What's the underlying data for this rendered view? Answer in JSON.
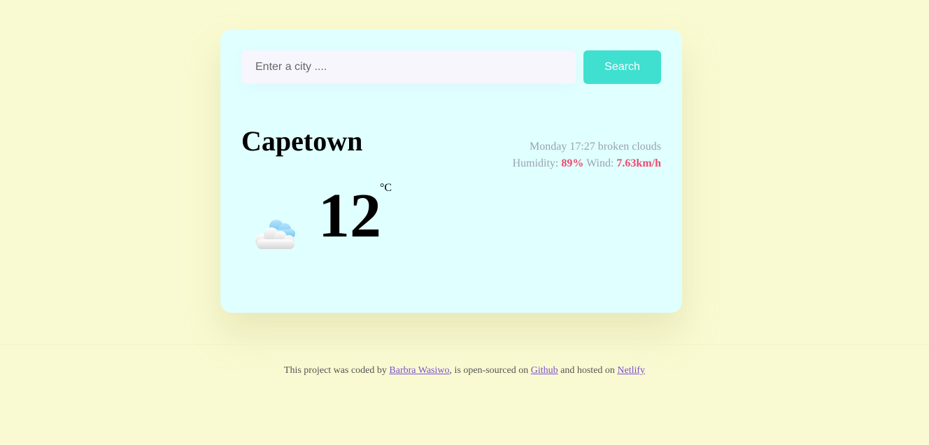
{
  "search": {
    "placeholder": "Enter a city ....",
    "value": "",
    "button_label": "Search"
  },
  "weather": {
    "city": "Capetown",
    "day_time": "Monday 17:27",
    "description": "broken clouds",
    "humidity_label": "Humidity:",
    "humidity_value": "89%",
    "wind_label": "Wind:",
    "wind_value": "7.63km/h",
    "temperature": "12",
    "unit": "°C",
    "icon": "broken-clouds-icon"
  },
  "footer": {
    "text_before": "This project was coded by",
    "author_link": "Barbra Wasiwo",
    "text_middle": ", is open-sourced on",
    "github_link": "Github",
    "text_after": "and hosted on",
    "netlify_link": "Netlify"
  },
  "colors": {
    "background": "#fafad2",
    "card": "#e0ffff",
    "accent": "#40e0d0",
    "highlight": "#ef4a6f",
    "link": "#7b52d1"
  }
}
